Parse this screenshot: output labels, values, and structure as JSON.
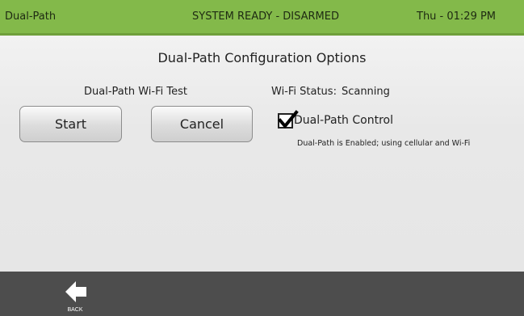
{
  "status_bar": {
    "title": "Dual-Path",
    "state": "SYSTEM READY - DISARMED",
    "time": "Thu - 01:29 PM",
    "color": "#83b94a"
  },
  "page": {
    "title": "Dual-Path Configuration Options"
  },
  "wifi_test": {
    "label": "Dual-Path Wi-Fi Test",
    "start_label": "Start",
    "cancel_label": "Cancel"
  },
  "wifi_status": {
    "label": "Wi-Fi Status:",
    "value": "Scanning"
  },
  "dual_path_control": {
    "label": "Dual-Path Control",
    "checked": true,
    "hint": "Dual-Path is Enabled; using cellular and Wi-Fi"
  },
  "footer": {
    "back_label": "BACK",
    "back_icon": "arrow-left-icon"
  }
}
